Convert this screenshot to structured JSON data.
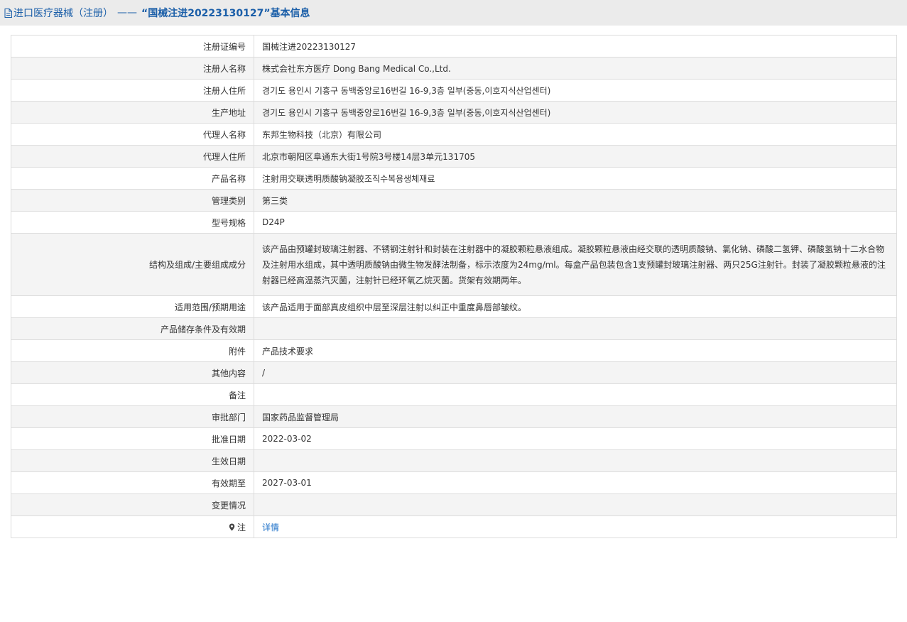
{
  "header": {
    "icon": "document-icon",
    "title_prefix": "进口医疗器械（注册）",
    "dash": "——",
    "title_quoted": "“国械注进20223130127”基本信息"
  },
  "rows": [
    {
      "label": "注册证编号",
      "value": "国械注进20223130127"
    },
    {
      "label": "注册人名称",
      "value": "株式会社东方医疗 Dong Bang Medical Co.,Ltd."
    },
    {
      "label": "注册人住所",
      "value": "경기도 용인시 기흥구 동백중앙로16번길 16-9,3층 일부(중동,이호지식산업센터)"
    },
    {
      "label": "生产地址",
      "value": "경기도 용인시 기흥구 동백중앙로16번길 16-9,3층 일부(중동,이호지식산업센터)"
    },
    {
      "label": "代理人名称",
      "value": "东邦生物科技（北京）有限公司"
    },
    {
      "label": "代理人住所",
      "value": "北京市朝阳区阜通东大街1号院3号楼14层3单元131705"
    },
    {
      "label": "产品名称",
      "value": "注射用交联透明质酸钠凝胶조직수복용생체재료"
    },
    {
      "label": "管理类别",
      "value": "第三类"
    },
    {
      "label": "型号规格",
      "value": "D24P"
    },
    {
      "label": "结构及组成/主要组成成分",
      "value": "该产品由预罐封玻璃注射器、不锈钢注射针和封装在注射器中的凝胶颗粒悬液组成。凝胶颗粒悬液由经交联的透明质酸钠、氯化钠、磷酸二氢钾、磷酸氢钠十二水合物及注射用水组成，其中透明质酸钠由微生物发酵法制备，标示浓度为24mg/ml。每盒产品包装包含1支预罐封玻璃注射器、两只25G注射针。封装了凝胶颗粒悬液的注射器已经高温蒸汽灭菌，注射针已经环氧乙烷灭菌。货架有效期两年。"
    },
    {
      "label": "适用范围/预期用途",
      "value": "该产品适用于面部真皮组织中层至深层注射以纠正中重度鼻唇部皱纹。"
    },
    {
      "label": "产品储存条件及有效期",
      "value": ""
    },
    {
      "label": "附件",
      "value": "产品技术要求"
    },
    {
      "label": "其他内容",
      "value": "/"
    },
    {
      "label": "备注",
      "value": ""
    },
    {
      "label": "审批部门",
      "value": "国家药品监督管理局"
    },
    {
      "label": "批准日期",
      "value": "2022-03-02"
    },
    {
      "label": "生效日期",
      "value": ""
    },
    {
      "label": "有效期至",
      "value": "2027-03-01"
    },
    {
      "label": "变更情况",
      "value": ""
    }
  ],
  "note": {
    "icon": "pin-icon",
    "label": "注",
    "link_text": "详情"
  },
  "colors": {
    "header_bg": "#ebebeb",
    "header_text": "#1a5ea8",
    "row_alt_bg": "#f4f4f4",
    "border": "#dcdcdc",
    "link": "#1a6fc8"
  }
}
